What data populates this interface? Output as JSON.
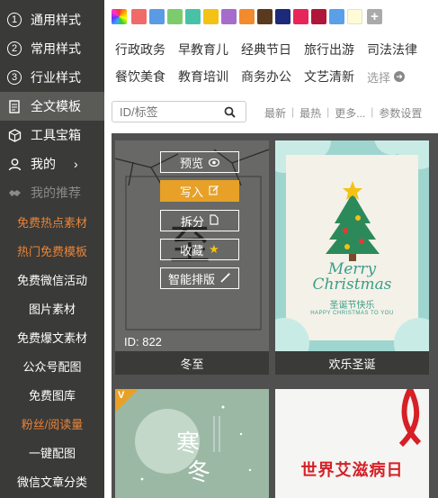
{
  "sidebar": {
    "items": [
      {
        "num": "1",
        "label": "通用样式"
      },
      {
        "num": "2",
        "label": "常用样式"
      },
      {
        "num": "3",
        "label": "行业样式"
      }
    ],
    "full_template": "全文模板",
    "toolbox": "工具宝箱",
    "mine": "我的",
    "mine_chevron": "›",
    "recommend": "我的推荐",
    "links": [
      {
        "label": "免费热点素材",
        "color": "orange"
      },
      {
        "label": "热门免费模板",
        "color": "orange"
      },
      {
        "label": "免费微信活动",
        "color": "white"
      },
      {
        "label": "图片素材",
        "color": "white"
      },
      {
        "label": "免费爆文素材",
        "color": "white"
      },
      {
        "label": "公众号配图",
        "color": "white"
      },
      {
        "label": "免费图库",
        "color": "white"
      },
      {
        "label": "粉丝/阅读量",
        "color": "orange"
      },
      {
        "label": "一键配图",
        "color": "white"
      },
      {
        "label": "微信文章分类",
        "color": "white"
      }
    ]
  },
  "colors": [
    "#f06a6a",
    "#5b9be6",
    "#7ccc6e",
    "#48c2a6",
    "#f3c214",
    "#a56ccc",
    "#f28a2e",
    "#5a3a1e",
    "#1d2a7a",
    "#e8245a",
    "#b0163a",
    "#5aa0e8",
    "#fffbd6"
  ],
  "categories": {
    "row1": [
      "行政政务",
      "早教育儿",
      "经典节日",
      "旅行出游",
      "司法法律"
    ],
    "row2": [
      "餐饮美食",
      "教育培训",
      "商务办公",
      "文艺清新"
    ],
    "more_label": "选择"
  },
  "search": {
    "placeholder": "ID/标签"
  },
  "sorts": [
    "最新",
    "最热",
    "更多...",
    "参数设置"
  ],
  "cards": {
    "c1": {
      "title": "冬至",
      "id_label": "ID: 822",
      "char": "至",
      "buttons": {
        "preview": "预览",
        "write": "写入",
        "split": "拆分",
        "favorite": "收藏",
        "smart": "智能排版"
      }
    },
    "c2": {
      "title": "欢乐圣诞",
      "script1": "Merry",
      "script2": "Christmas",
      "cn_sub": "圣诞节快乐",
      "en_sub": "HAPPY CHRISTMAS TO YOU"
    },
    "c3": {
      "badge": "V",
      "char1": "寒",
      "char2": "冬"
    },
    "c4": {
      "headline": "世界艾滋病日"
    }
  },
  "accent": "#e7a128"
}
